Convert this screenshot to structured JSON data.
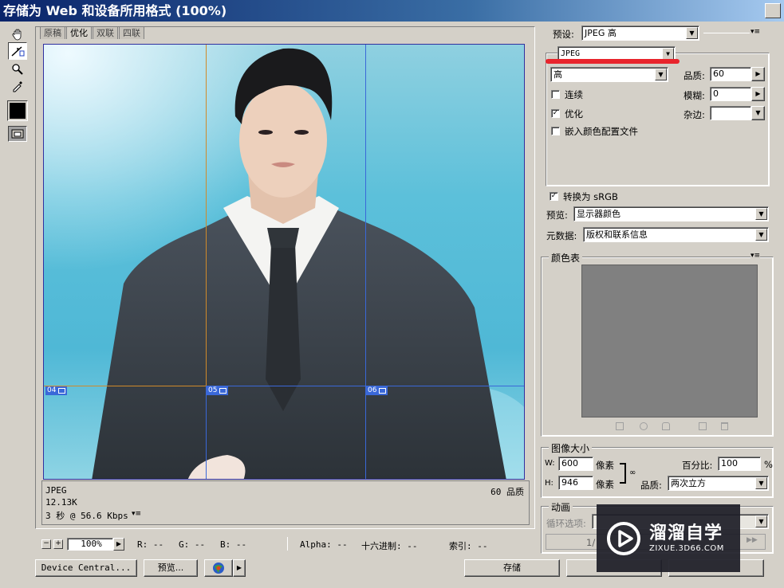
{
  "window": {
    "title": "存储为 Web 和设备所用格式 (100%)"
  },
  "tabs": [
    {
      "label": "原稿",
      "active": false
    },
    {
      "label": "优化",
      "active": true
    },
    {
      "label": "双联",
      "active": false
    },
    {
      "label": "四联",
      "active": false
    }
  ],
  "slices": [
    {
      "label": "04"
    },
    {
      "label": "05"
    },
    {
      "label": "06"
    }
  ],
  "preview_info": {
    "format": "JPEG",
    "size": "12.13K",
    "time": "3 秒 @ 56.6 Kbps",
    "quality": "60 品质"
  },
  "statusbar": {
    "zoom": "100%",
    "r": "R: --",
    "g": "G: --",
    "b": "B: --",
    "alpha": "Alpha: --",
    "hex": "十六进制: --",
    "index": "索引: --"
  },
  "bottom_buttons": {
    "device_central": "Device Central...",
    "preview": "预览...",
    "save": "存储"
  },
  "settings": {
    "preset_label": "预设:",
    "preset_value": "JPEG 高",
    "format_value": "JPEG",
    "quality_level": "高",
    "quality_label": "品质:",
    "quality_value": "60",
    "progressive_label": "连续",
    "progressive_checked": false,
    "blur_label": "模糊:",
    "blur_value": "0",
    "optimized_label": "优化",
    "optimized_checked": true,
    "matte_label": "杂边:",
    "matte_value": "",
    "embed_profile_label": "嵌入颜色配置文件",
    "embed_profile_checked": false,
    "convert_srgb_label": "转换为 sRGB",
    "convert_srgb_checked": true,
    "preview_label": "预览:",
    "preview_value": "显示器颜色",
    "metadata_label": "元数据:",
    "metadata_value": "版权和联系信息"
  },
  "color_table": {
    "title": "颜色表"
  },
  "image_size": {
    "title": "图像大小",
    "w_label": "W:",
    "w_value": "600",
    "h_label": "H:",
    "h_value": "946",
    "unit": "像素",
    "percent_label": "百分比:",
    "percent_value": "100",
    "percent_unit": "%",
    "quality_label": "品质:",
    "quality_value": "两次立方"
  },
  "animation": {
    "title": "动画",
    "loop_label": "循环选项:",
    "frame": "1/"
  },
  "watermark": {
    "brand": "溜溜自学",
    "url": "ZIXUE.3D66.COM"
  },
  "colors": {
    "annotation_red": "#e8242c",
    "slice_blue": "#3a68d8",
    "slice_orange": "#d08a2a"
  }
}
